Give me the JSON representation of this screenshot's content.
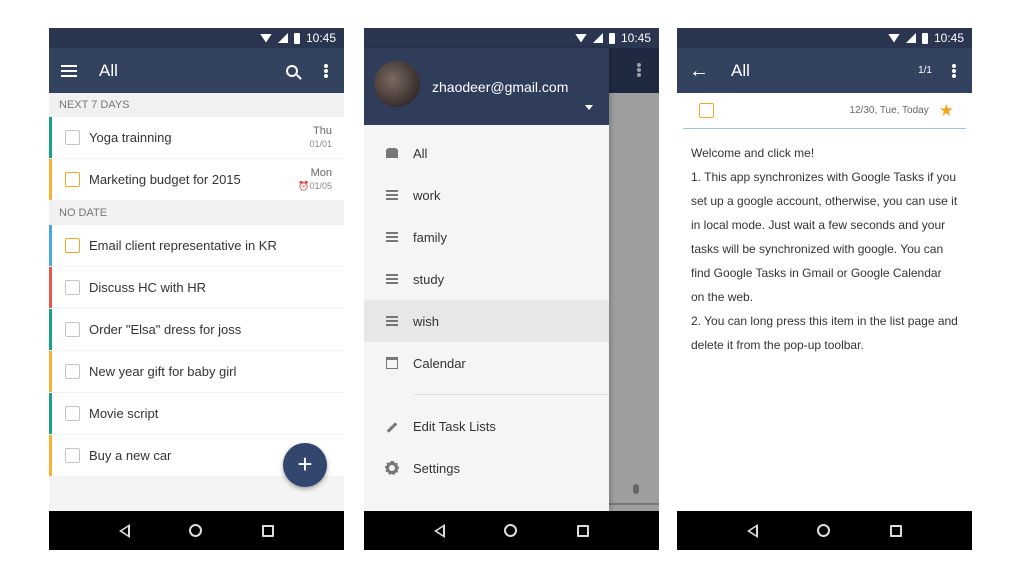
{
  "status_bar": {
    "time": "10:45"
  },
  "screen1": {
    "title": "All",
    "sections": [
      {
        "label": "NEXT 7 DAYS",
        "tasks": [
          {
            "label": "Yoga trainning",
            "day": "Thu",
            "date": "01/01",
            "edge_color": "#1a9e8f",
            "checkbox": "gray"
          },
          {
            "label": "Marketing budget for 2015",
            "day": "Mon",
            "date": "⏰01/05",
            "edge_color": "#f7b233",
            "checkbox": "orange"
          }
        ]
      },
      {
        "label": "NO DATE",
        "tasks": [
          {
            "label": "Email client representative in KR",
            "edge_color": "#4aa8e0",
            "checkbox": "orange"
          },
          {
            "label": "Discuss HC with HR",
            "edge_color": "#e6574a",
            "checkbox": "gray"
          },
          {
            "label": "Order \"Elsa\" dress for joss",
            "edge_color": "#1a9e8f",
            "checkbox": "gray"
          },
          {
            "label": "New year gift for baby girl",
            "edge_color": "#f7b233",
            "checkbox": "gray"
          },
          {
            "label": "Movie script",
            "edge_color": "#1a9e8f",
            "checkbox": "gray"
          },
          {
            "label": "Buy a new car",
            "edge_color": "#f7b233",
            "checkbox": "gray"
          }
        ]
      }
    ],
    "fab_label": "+"
  },
  "screen2": {
    "account_email": "zhaodeer@gmail.com",
    "items": [
      {
        "label": "All",
        "icon": "stack-icon"
      },
      {
        "label": "work",
        "icon": "list-icon"
      },
      {
        "label": "family",
        "icon": "list-icon"
      },
      {
        "label": "study",
        "icon": "list-icon"
      },
      {
        "label": "wish",
        "icon": "list-icon",
        "active": true
      },
      {
        "label": "Calendar",
        "icon": "calendar-icon"
      }
    ],
    "footer_items": [
      {
        "label": "Edit Task Lists",
        "icon": "pencil-icon"
      },
      {
        "label": "Settings",
        "icon": "gear-icon"
      }
    ]
  },
  "screen3": {
    "title": "All",
    "counter": "1/1",
    "due": "12/30, Tue, Today",
    "note": "Welcome and click me!\n1. This app synchronizes with Google Tasks if you set up a google account, otherwise, you can use it in local mode. Just wait a few seconds and your tasks will be synchronized with google. You can find Google Tasks in Gmail or Google Calendar on the web.\n 2. You can long press this item in the list page and delete it from the pop-up toolbar."
  },
  "colors": {
    "appbar": "#33425f",
    "accent": "#f5a623",
    "fab": "#33466e"
  }
}
